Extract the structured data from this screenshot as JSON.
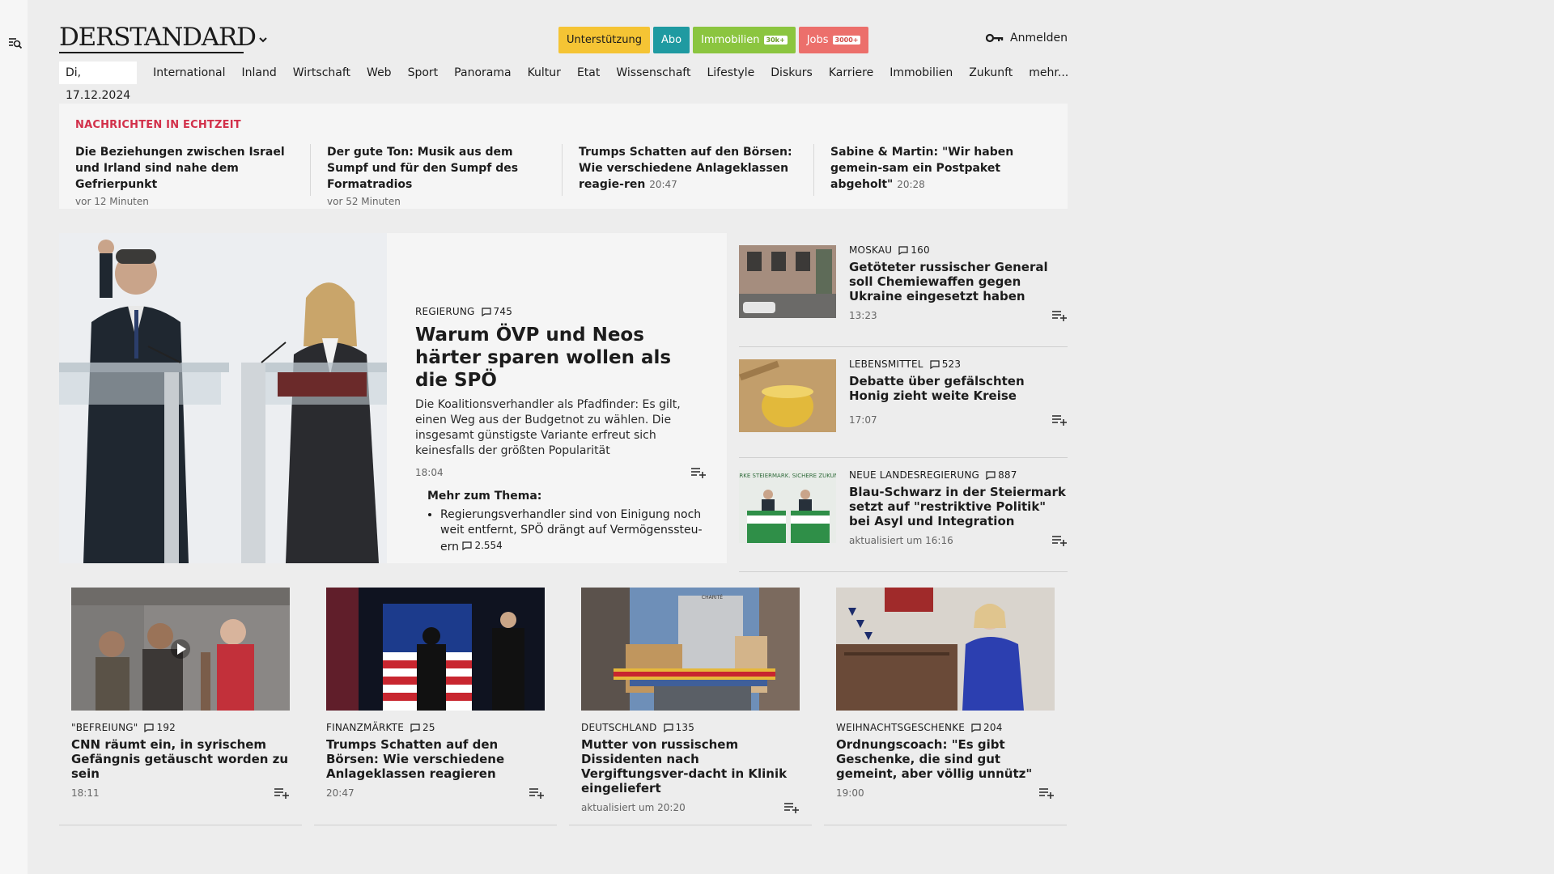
{
  "header": {
    "logo": "DERSTANDARD",
    "pills": {
      "support": "Unterstützung",
      "abo": "Abo",
      "immobilien": "Immobilien",
      "immobilien_badge": "30k+",
      "jobs": "Jobs",
      "jobs_badge": "3000+"
    },
    "login": "Anmelden"
  },
  "nav": {
    "date": "Di, 17.12.2024",
    "items": [
      "International",
      "Inland",
      "Wirtschaft",
      "Web",
      "Sport",
      "Panorama",
      "Kultur",
      "Etat",
      "Wissenschaft",
      "Lifestyle",
      "Diskurs",
      "Karriere",
      "Immobilien",
      "Zukunft",
      "mehr..."
    ]
  },
  "breaking": {
    "title": "NACHRICHTEN IN ECHTZEIT",
    "items": [
      {
        "title": "Die Beziehungen zwischen Israel und Irland sind nahe dem Gefrierpunkt",
        "time": "vor 12 Minuten"
      },
      {
        "title": "Der gute Ton: Musik aus dem Sumpf und für den Sumpf des Formatradios",
        "time": "vor 52 Minuten"
      },
      {
        "title": "Trumps Schatten auf den Börsen: Wie verschiedene Anlageklassen reagie-ren",
        "time": "20:47"
      },
      {
        "title": "Sabine & Martin: \"Wir haben gemein-sam ein Postpaket abgeholt\"",
        "time": "20:28"
      }
    ]
  },
  "lead": {
    "kicker": "REGIERUNG",
    "comments": "745",
    "title": "Warum ÖVP und Neos härter sparen wollen als die SPÖ",
    "teaser": "Die Koalitionsverhandler als Pfadfinder: Es gilt, einen Weg aus der Budgetnot zu wählen. Die insgesamt günstigste Variante erfreut sich keinesfalls der größten Popularität",
    "time": "18:04",
    "more_title": "Mehr zum Thema:",
    "more_item": "Regierungsverhandler sind von Einigung noch weit entfernt, SPÖ drängt auf Vermögenssteu-ern",
    "more_comments": "2.554"
  },
  "side": [
    {
      "kicker": "MOSKAU",
      "comments": "160",
      "title": "Getöteter russischer General soll Chemiewaffen gegen Ukraine eingesetzt haben",
      "time": "13:23"
    },
    {
      "kicker": "LEBENSMITTEL",
      "comments": "523",
      "title": "Debatte über gefälschten Honig zieht weite Kreise",
      "time": "17:07"
    },
    {
      "kicker": "NEUE LANDESREGIERUNG",
      "comments": "887",
      "title": "Blau-Schwarz in der Steiermark setzt auf \"restriktive Politik\" bei Asyl und Integration",
      "time": "aktualisiert um 16:16",
      "img_text": "STARKE STEIERMARK. SICHERE ZUKUNFT."
    }
  ],
  "cards": [
    {
      "kicker": "\"BEFREIUNG\"",
      "comments": "192",
      "title": "CNN räumt ein, in syrischem Gefängnis getäuscht worden zu sein",
      "time": "18:11"
    },
    {
      "kicker": "FINANZMÄRKTE",
      "comments": "25",
      "title": "Trumps Schatten auf den Börsen: Wie verschiedene Anlageklassen reagieren",
      "time": "20:47"
    },
    {
      "kicker": "DEUTSCHLAND",
      "comments": "135",
      "title": "Mutter von russischem Dissidenten nach Vergiftungsver-dacht in Klinik eingeliefert",
      "time": "aktualisiert um 20:20",
      "img_text": "CHARITÉ"
    },
    {
      "kicker": "WEIHNACHTSGESCHENKE",
      "comments": "204",
      "title": "Ordnungscoach: \"Es gibt Geschenke, die sind gut gemeint, aber völlig unnütz\"",
      "time": "19:00"
    }
  ]
}
